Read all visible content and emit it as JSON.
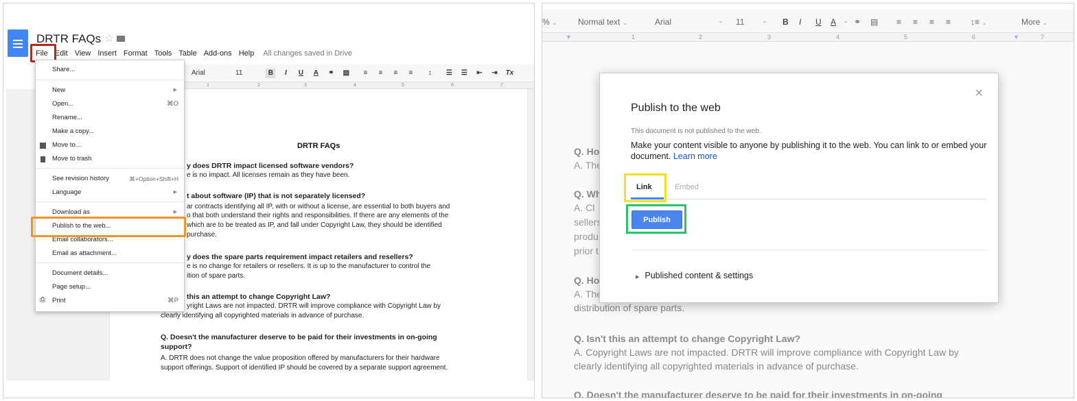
{
  "left": {
    "doc_title": "DRTR FAQs",
    "menubar": [
      "File",
      "Edit",
      "View",
      "Insert",
      "Format",
      "Tools",
      "Table",
      "Add-ons",
      "Help"
    ],
    "saved_status": "All changes saved in Drive",
    "toolbar": {
      "font": "Arial",
      "size": "11",
      "bold": "B",
      "italic": "I",
      "underline": "U",
      "color": "A",
      "clear": "Tx"
    },
    "ruler_ticks": [
      "1",
      "2",
      "3",
      "4",
      "5",
      "6",
      "7"
    ],
    "file_menu": {
      "share": "Share...",
      "new": "New",
      "open": "Open...",
      "open_sc": "⌘O",
      "rename": "Rename...",
      "make_copy": "Make a copy...",
      "move_to": "Move to...",
      "move_trash": "Move to trash",
      "revision": "See revision history",
      "revision_sc": "⌘+Option+Shift+H",
      "language": "Language",
      "download": "Download as",
      "publish": "Publish to the web...",
      "email_collab": "Email collaborators...",
      "email_attach": "Email as attachment...",
      "details": "Document details...",
      "page_setup": "Page setup...",
      "print": "Print",
      "print_sc": "⌘P"
    },
    "doc": {
      "heading": "DRTR FAQs",
      "lines": [
        {
          "t": "y does DRTR impact licensed software vendors?",
          "q": true
        },
        {
          "t": "e is no impact. All licenses remain as they have been.",
          "q": false
        },
        {
          "t": "t about software (IP) that is not separately licensed?",
          "q": true
        },
        {
          "t": "ar contracts identifying all IP, with or without a license, are essential to both buyers and",
          "q": false
        },
        {
          "t": "o that both understand their rights and responsibilities.  If there are any elements of the",
          "q": false
        },
        {
          "t": "which are to be treated as IP, and fall under Copyright Law, they should be identified",
          "q": false
        },
        {
          "t": "purchase.",
          "q": false
        },
        {
          "t": "y does the spare parts requirement impact retailers and resellers?",
          "q": true
        },
        {
          "t": "e is no change for retailers or resellers. It is up to the manufacturer to control the",
          "q": false
        },
        {
          "t": "ition of spare parts.",
          "q": false
        },
        {
          "t": "this an attempt to change Copyright Law?",
          "q": true
        },
        {
          "t": "yright Laws are not impacted. DRTR will improve compliance with Copyright Law by",
          "q": false
        },
        {
          "t": "clearly identifying all copyrighted materials in advance of purchase.",
          "q": false
        },
        {
          "t": "Q. Doesn't the manufacturer deserve to be paid for their investments in on-going",
          "q": true
        },
        {
          "t": "support?",
          "q": true
        },
        {
          "t": "A. DRTR does not change the value proposition offered by manufacturers for their hardware",
          "q": false
        },
        {
          "t": "support offerings. Support of identified IP should be covered by a separate support agreement.",
          "q": false
        }
      ]
    }
  },
  "right": {
    "toolbar": {
      "zoom_partial": "%",
      "style": "Normal text",
      "font": "Arial",
      "size": "11",
      "bold": "B",
      "italic": "I",
      "underline": "U",
      "color": "A",
      "more": "More"
    },
    "ruler_ticks": [
      "1",
      "2",
      "3",
      "4",
      "5",
      "6",
      "7"
    ],
    "dialog": {
      "title": "Publish to the web",
      "close": "×",
      "note": "This document is not published to the web.",
      "desc": "Make your content visible to anyone by publishing it to the web. You can link to or embed your document.",
      "learn_more": "Learn more",
      "tab_link": "Link",
      "tab_embed": "Embed",
      "publish_button": "Publish",
      "settings": "Published content & settings"
    },
    "background_text": {
      "q1": "Q. Ho",
      "a1": "A. The",
      "q2": "Q. Wh",
      "a2": "A.  Cl",
      "a2b": "sellers",
      "a2c": "produ",
      "a2d": "prior t",
      "q3": "Q. Ho",
      "a3": "A. The",
      "a3b": "distribution of spare parts.",
      "q4": "Q. Isn't this an attempt to change Copyright Law?",
      "a4": "A. Copyright Laws are not impacted. DRTR will improve compliance with Copyright Law by",
      "a4b": "clearly identifying all copyrighted materials in advance of purchase.",
      "q5": "Q. Doesn't the manufacturer deserve to be paid for their investments in on-going"
    }
  },
  "colors": {
    "file_highlight": "#b2291e",
    "publish_highlight": "#f39327",
    "link_highlight": "#f5e01c",
    "button_highlight": "#27c46a",
    "accent": "#4285f4"
  }
}
